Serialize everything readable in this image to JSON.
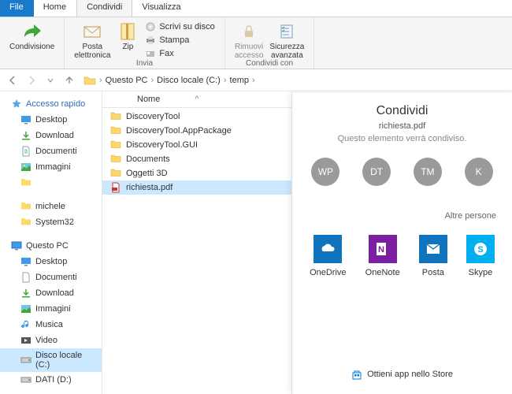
{
  "tabs": {
    "file": "File",
    "home": "Home",
    "condividi": "Condividi",
    "visualizza": "Visualizza"
  },
  "ribbon": {
    "condivisione": "Condivisione",
    "posta": "Posta\nelettronica",
    "zip": "Zip",
    "scrivi": "Scrivi su disco",
    "stampa": "Stampa",
    "fax": "Fax",
    "invia_group": "Invia",
    "rimuovi": "Rimuovi\naccesso",
    "sicurezza": "Sicurezza\navanzata",
    "condividi_group": "Condividi con"
  },
  "breadcrumb": {
    "pc": "Questo PC",
    "disk": "Disco locale (C:)",
    "temp": "temp"
  },
  "columns": {
    "nome": "Nome"
  },
  "sidebar": {
    "quick": "Accesso rapido",
    "desktop": "Desktop",
    "download": "Download",
    "documenti": "Documenti",
    "immagini": "Immagini",
    "michele": "michele",
    "system32": "System32",
    "thispc": "Questo PC",
    "musica": "Musica",
    "video": "Video",
    "disk": "Disco locale (C:)",
    "dati": "DATI (D:)"
  },
  "files": [
    {
      "name": "DiscoveryTool",
      "type": "folder"
    },
    {
      "name": "DiscoveryTool.AppPackage",
      "type": "folder"
    },
    {
      "name": "DiscoveryTool.GUI",
      "type": "folder"
    },
    {
      "name": "Documents",
      "type": "folder"
    },
    {
      "name": "Oggetti 3D",
      "type": "folder"
    },
    {
      "name": "richiesta.pdf",
      "type": "pdf",
      "selected": true
    }
  ],
  "share": {
    "title": "Condividi",
    "file": "richiesta.pdf",
    "subtitle": "Questo elemento verrà condiviso.",
    "contacts": [
      "WP",
      "DT",
      "TM",
      "K"
    ],
    "other": "Altre persone",
    "apps": [
      {
        "name": "OneDrive",
        "color": "#0f74bd"
      },
      {
        "name": "OneNote",
        "color": "#7a1fa0"
      },
      {
        "name": "Posta",
        "color": "#0f74bd"
      },
      {
        "name": "Skype",
        "color": "#00aff0"
      }
    ],
    "store": "Ottieni app nello Store"
  }
}
